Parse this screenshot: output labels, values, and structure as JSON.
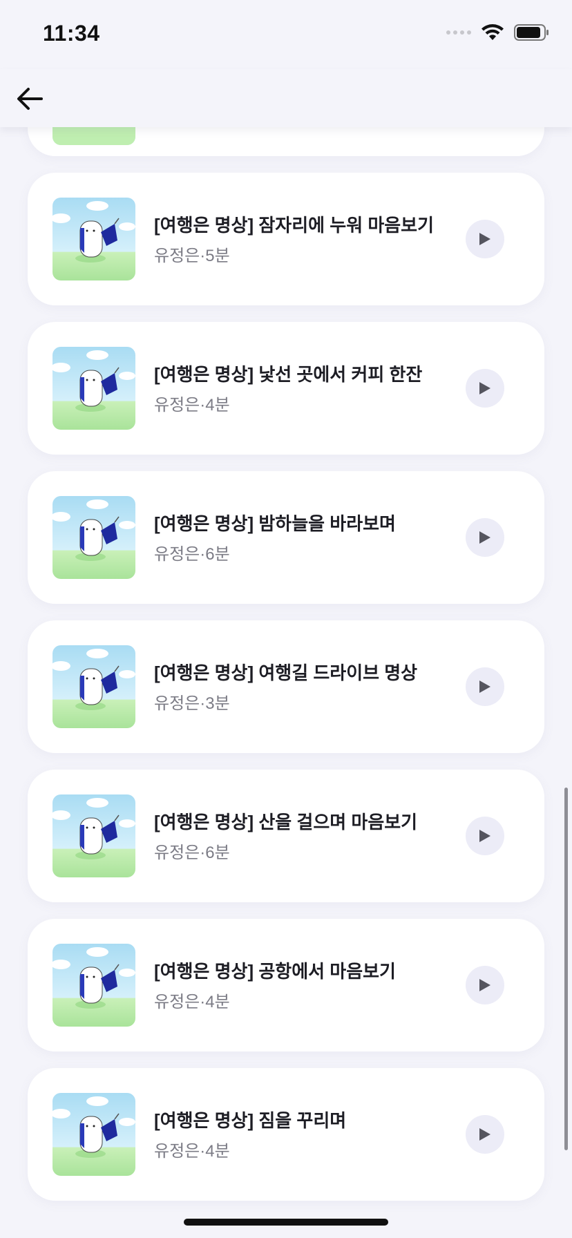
{
  "status_bar": {
    "time": "11:34"
  },
  "nav": {
    "back_icon": "arrow-left-icon"
  },
  "tracks": [
    {
      "title": "[여행은 명상] 잠자리에 누워 마음보기",
      "author": "유정은",
      "separator": "·",
      "duration": "5분"
    },
    {
      "title": "[여행은 명상] 낯선 곳에서 커피 한잔",
      "author": "유정은",
      "separator": "·",
      "duration": "4분"
    },
    {
      "title": "[여행은 명상] 밤하늘을 바라보며",
      "author": "유정은",
      "separator": "·",
      "duration": "6분"
    },
    {
      "title": "[여행은 명상] 여행길 드라이브 명상",
      "author": "유정은",
      "separator": "·",
      "duration": "3분"
    },
    {
      "title": "[여행은 명상] 산을 걸으며 마음보기",
      "author": "유정은",
      "separator": "·",
      "duration": "6분"
    },
    {
      "title": "[여행은 명상] 공항에서 마음보기",
      "author": "유정은",
      "separator": "·",
      "duration": "4분"
    },
    {
      "title": "[여행은 명상] 짐을 꾸리며",
      "author": "유정은",
      "separator": "·",
      "duration": "4분"
    }
  ],
  "colors": {
    "background": "#f4f4fa",
    "play_button_bg": "#ececf7",
    "play_icon": "#55555f"
  }
}
